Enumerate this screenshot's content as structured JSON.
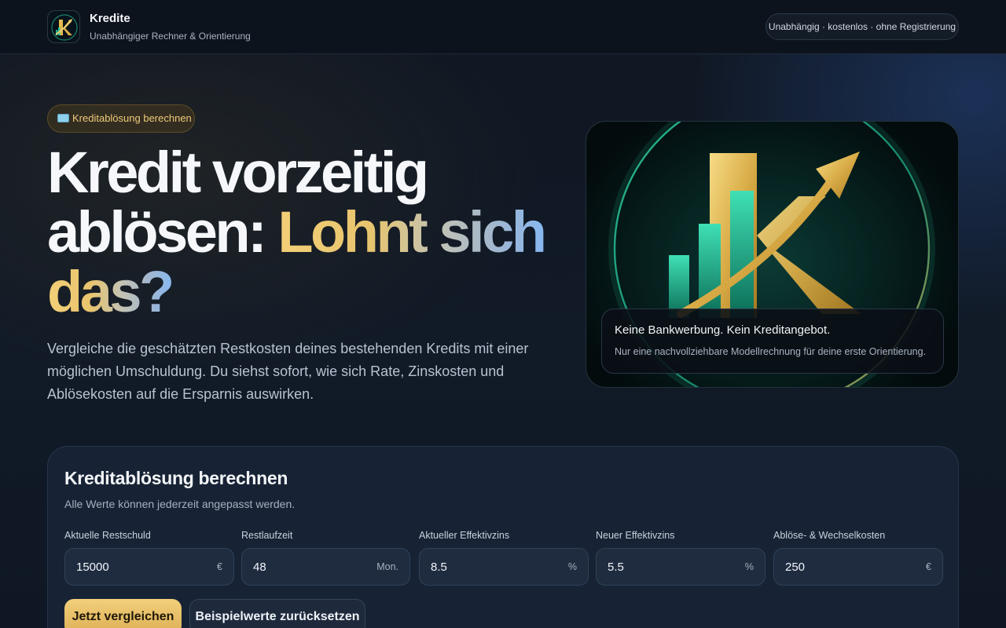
{
  "header": {
    "brand_name": "Kredite",
    "brand_sub": "Unabhängiger Rechner & Orientierung",
    "badge": "Unabhängig · kostenlos · ohne Registrierung"
  },
  "hero": {
    "pill_label": "Kreditablösung berechnen",
    "title_line1": "Kredit vorzeitig",
    "title_line2_plain": "ablösen: ",
    "title_line2_grad": "Lohnt sich",
    "title_line3_grad": "das?",
    "description": "Vergleiche die geschätzten Restkosten deines bestehenden Kredits mit einer möglichen Umschuldung. Du siehst sofort, wie sich Rate, Zinskosten und Ablösekosten auf die Ersparnis auswirken.",
    "image_caption_title": "Keine Bankwerbung. Kein Kreditangebot.",
    "image_caption_sub": "Nur eine nachvollziehbare Modellrechnung für deine erste Orientierung."
  },
  "calculator": {
    "title": "Kreditablösung berechnen",
    "subtitle": "Alle Werte können jederzeit angepasst werden.",
    "fields": [
      {
        "label": "Aktuelle Restschuld",
        "value": "15000",
        "unit": "€"
      },
      {
        "label": "Restlaufzeit",
        "value": "48",
        "unit": "Mon."
      },
      {
        "label": "Aktueller Effektivzins",
        "value": "8.5",
        "unit": "%"
      },
      {
        "label": "Neuer Effektivzins",
        "value": "5.5",
        "unit": "%"
      },
      {
        "label": "Ablöse- & Wechselkosten",
        "value": "250",
        "unit": "€"
      }
    ],
    "primary_button": "Jetzt vergleichen",
    "secondary_button": "Beispielwerte zurücksetzen"
  },
  "colors": {
    "accent_gold": "#e8c46e",
    "accent_blue": "#87b7f0",
    "background": "#111a27",
    "logo_green": "#1fb38f"
  },
  "icons": {
    "brand_logo": "k-growth-arrow-logo",
    "pill_icon": "banknote-icon",
    "hero_image": "k-growth-arrow-illustration"
  }
}
